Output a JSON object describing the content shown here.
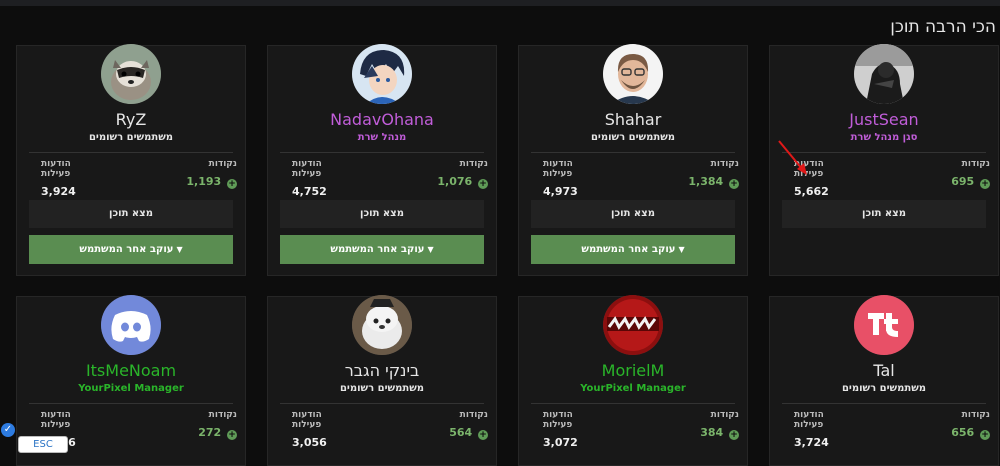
{
  "page": {
    "title": "הכי הרבה תוכן"
  },
  "labels": {
    "points": "נקודות",
    "posts": "הודעות פעילות",
    "find_content": "מצא תוכן",
    "follow": "עוקב אחר המשתמש",
    "plus": "+"
  },
  "colors": {
    "admin": "#c05dd8",
    "manager": "#2ab52a",
    "member": "#e6e6e6",
    "follow_button": "#5a8d51"
  },
  "cards": [
    {
      "name": "RyZ",
      "role": "משתמשים רשומים",
      "points": "1,193",
      "posts": "3,924",
      "avatar": "raccoon-avatar"
    },
    {
      "name": "NadavOhana",
      "role": "מנהל שרת",
      "points": "1,076",
      "posts": "4,752",
      "avatar": "anime-character-avatar"
    },
    {
      "name": "Shahar",
      "role": "משתמשים רשומים",
      "points": "1,384",
      "posts": "4,973",
      "avatar": "bearded-man-avatar"
    },
    {
      "name": "JustSean",
      "role": "סגן מנהל שרת",
      "points": "695",
      "posts": "5,662",
      "avatar": "dark-photo-avatar"
    },
    {
      "name": "ItsMeNoam",
      "role": "YourPixel Manager",
      "points": "272",
      "posts": "2,936",
      "avatar": "discord-logo-avatar"
    },
    {
      "name": "בינקי הגבר",
      "role": "משתמשים רשומים",
      "points": "564",
      "posts": "3,056",
      "avatar": "fluffy-dog-avatar"
    },
    {
      "name": "MorielM",
      "role": "YourPixel Manager",
      "points": "384",
      "posts": "3,072",
      "avatar": "red-logo-avatar"
    },
    {
      "name": "Tal",
      "role": "משתמשים רשומים",
      "points": "656",
      "posts": "3,724",
      "avatar": "tiktok-style-avatar"
    }
  ],
  "overlay": {
    "esc_label": "ESC",
    "check_symbol": "✓"
  }
}
